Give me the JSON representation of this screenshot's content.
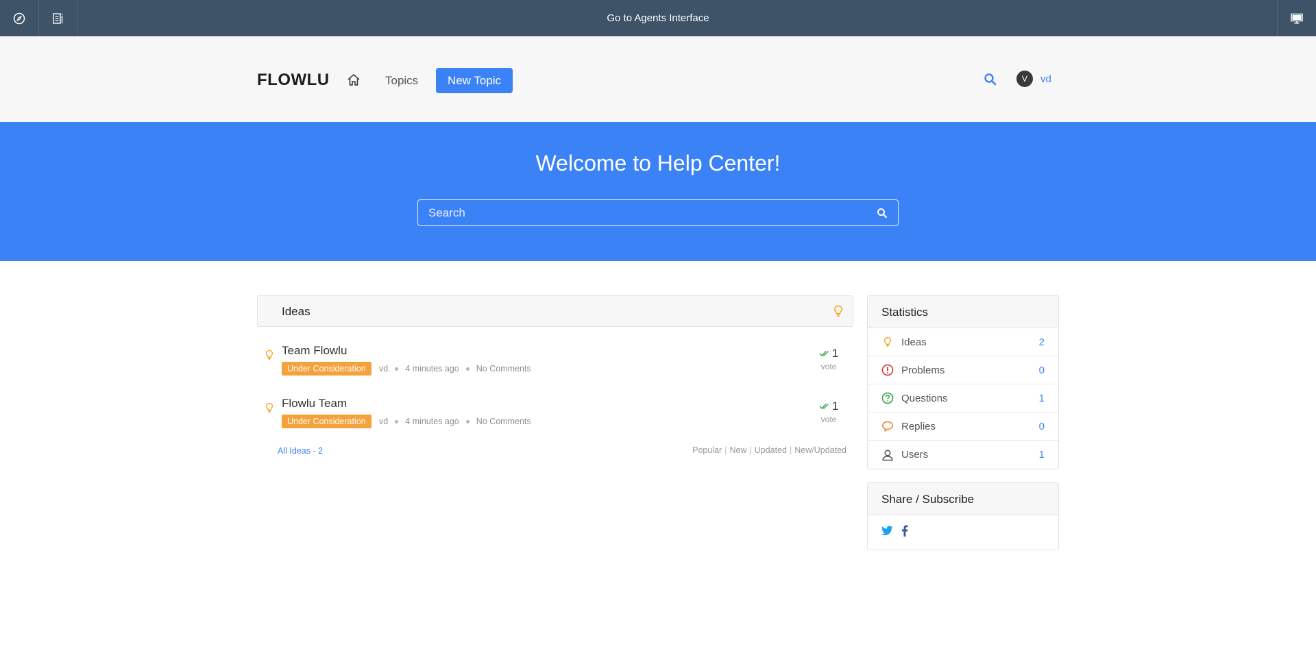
{
  "topbar": {
    "center_label": "Go to Agents Interface"
  },
  "header": {
    "logo": "FLOWLU",
    "topics_label": "Topics",
    "new_topic_label": "New Topic",
    "avatar_initial": "V",
    "user_name": "vd"
  },
  "hero": {
    "title": "Welcome to Help Center!",
    "search_placeholder": "Search"
  },
  "ideas": {
    "title": "Ideas",
    "topics": [
      {
        "title": "Team Flowlu",
        "status": "Under Consideration",
        "author": "vd",
        "time": "4 minutes ago",
        "comments": "No Comments",
        "votes": "1",
        "vote_label": "vote"
      },
      {
        "title": "Flowlu Team",
        "status": "Under Consideration",
        "author": "vd",
        "time": "4 minutes ago",
        "comments": "No Comments",
        "votes": "1",
        "vote_label": "vote"
      }
    ],
    "all_link": "All Ideas - 2",
    "sorts": [
      "Popular",
      "New",
      "Updated",
      "New/Updated"
    ]
  },
  "statistics": {
    "title": "Statistics",
    "rows": [
      {
        "label": "Ideas",
        "count": "2",
        "icon": "lightbulb-icon"
      },
      {
        "label": "Problems",
        "count": "0",
        "icon": "exclamation-circle-icon"
      },
      {
        "label": "Questions",
        "count": "1",
        "icon": "question-circle-icon"
      },
      {
        "label": "Replies",
        "count": "0",
        "icon": "speech-bubble-icon"
      },
      {
        "label": "Users",
        "count": "1",
        "icon": "user-icon"
      }
    ]
  },
  "share": {
    "title": "Share / Subscribe"
  },
  "colors": {
    "topbar": "#3e5268",
    "accent": "#3b82f6",
    "badge": "#f5a13c",
    "idea_icon": "#f5a623",
    "problem_icon": "#d32f2f",
    "question_icon": "#2e9e3e",
    "reply_icon": "#e67e22"
  }
}
